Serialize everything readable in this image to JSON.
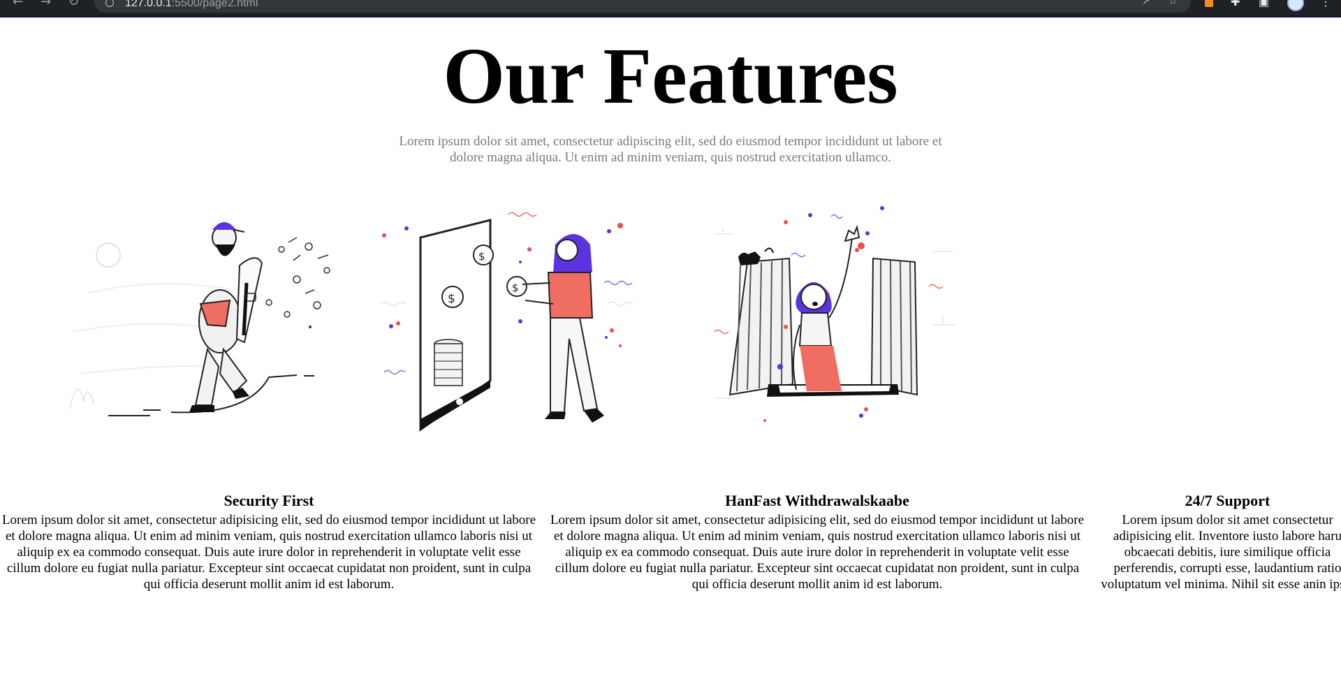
{
  "browser": {
    "url_host": "127.0.0.1",
    "url_rest": ":5500/page2.html",
    "icons": [
      "back-arrow-icon",
      "forward-arrow-icon",
      "reload-icon",
      "info-icon",
      "share-icon",
      "star-icon",
      "extension-icon",
      "puzzle-icon",
      "sidebar-icon",
      "profile-avatar",
      "menu-icon"
    ]
  },
  "page": {
    "title": "Our Features",
    "subtitle": "Lorem ipsum dolor sit amet, consectetur adipiscing elit, sed do eiusmod tempor incididunt ut labore et dolore magna aliqua. Ut enim ad minim veniam, quis nostrud exercitation ullamco."
  },
  "features": [
    {
      "title": "Security First",
      "text": "Lorem ipsum dolor sit amet, consectetur adipisicing elit, sed do eiusmod tempor incididunt ut labore et dolore magna aliqua. Ut enim ad minim veniam, quis nostrud exercitation ullamco laboris nisi ut aliquip ex ea commodo consequat. Duis aute irure dolor in reprehenderit in voluptate velit esse cillum dolore eu fugiat nulla pariatur. Excepteur sint occaecat cupidatat non proident, sunt in culpa qui officia deserunt mollit anim id est laborum.",
      "illustration": "security-illustration"
    },
    {
      "title": "HanFast Withdrawalskaabe",
      "text": "Lorem ipsum dolor sit amet, consectetur adipisicing elit, sed do eiusmod tempor incididunt ut labore et dolore magna aliqua. Ut enim ad minim veniam, quis nostrud exercitation ullamco laboris nisi ut aliquip ex ea commodo consequat. Duis aute irure dolor in reprehenderit in voluptate velit esse cillum dolore eu fugiat nulla pariatur. Excepteur sint occaecat cupidatat non proident, sunt in culpa qui officia deserunt mollit anim id est laborum.",
      "illustration": "withdrawal-illustration"
    },
    {
      "title": "24/7 Support",
      "text": "Lorem ipsum dolor sit amet consectetur adipisicing elit. Inventore iusto labore haru obcaecati debitis, iure similique officia perferendis, corrupti esse, laudantium ratio voluptatum vel minima. Nihil sit esse anin ipsa.",
      "illustration": "support-illustration"
    }
  ],
  "colors": {
    "accent_purple": "#5b34e0",
    "accent_red": "#e8514f",
    "chrome_bg": "#202124"
  }
}
